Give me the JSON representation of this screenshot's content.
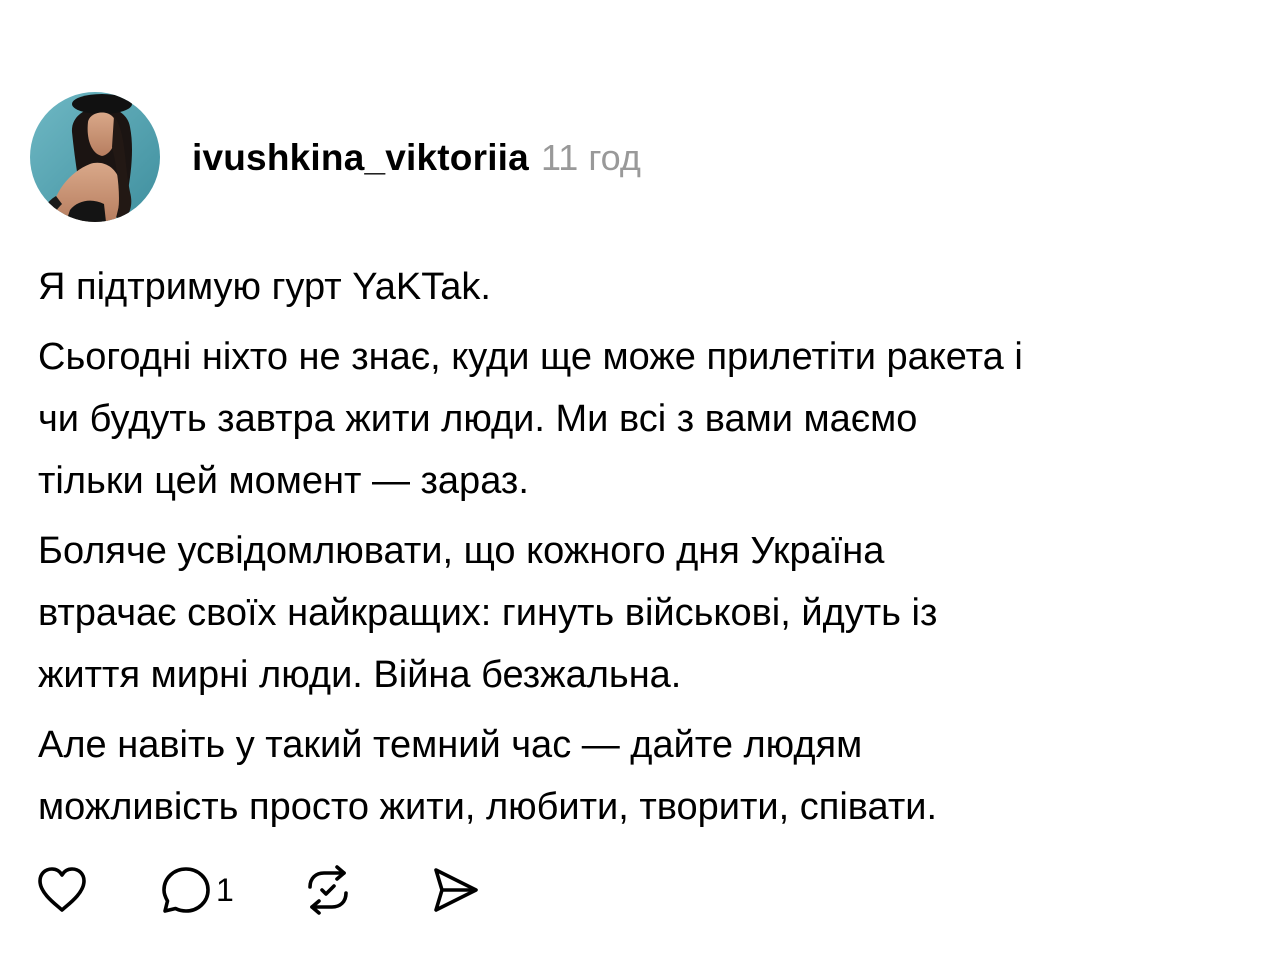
{
  "post": {
    "author": {
      "username": "ivushkina_viktoriia",
      "timestamp": "11 год",
      "avatar_icon": "avatar-photo"
    },
    "paragraphs": [
      "Я підтримую гурт YaKTak.",
      "Сьогодні ніхто не знає, куди ще може прилетіти ракета і\nчи будуть завтра жити люди. Ми всі з вами маємо\nтільки цей момент — зараз.",
      "Боляче усвідомлювати, що кожного дня Україна\nвтрачає своїх найкращих: гинуть військові, йдуть із\nжиття мирні люди. Війна безжальна.",
      "Але навіть у такий темний час — дайте людям\nможливість просто жити, любити, творити, співати."
    ],
    "actions": {
      "like_icon": "heart-icon",
      "reply_icon": "comment-icon",
      "reply_count": "1",
      "repost_icon": "repost-icon",
      "share_icon": "send-icon"
    }
  },
  "colors": {
    "text": "#000000",
    "secondary": "#999999",
    "background": "#ffffff"
  }
}
